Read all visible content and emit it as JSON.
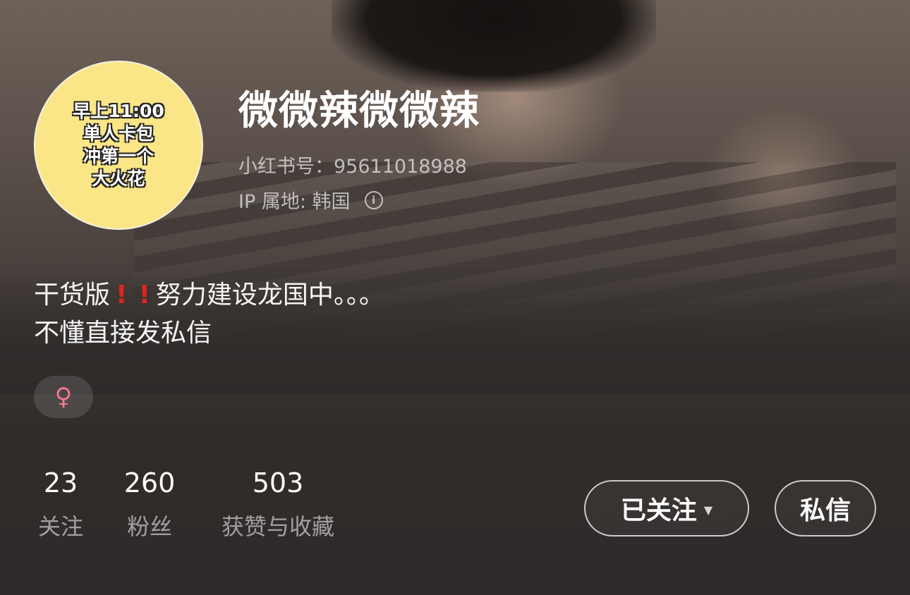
{
  "profile": {
    "avatar_lines": [
      "早上11:00",
      "单人卡包",
      "冲第一个",
      "大火花"
    ],
    "name": "微微辣微微辣",
    "red_id": "小红书号：95611018988",
    "ip": "IP 属地: 韩国",
    "bio": {
      "line1_start": "干货版",
      "bang": "!",
      "line1_end": "努力建设龙国中。。。",
      "line2": "不懂直接发私信"
    },
    "gender_symbol": "♀",
    "gender_icon": "female-icon"
  },
  "stats": [
    {
      "value": "23",
      "label": "关注"
    },
    {
      "value": "260",
      "label": "粉丝"
    },
    {
      "value": "503",
      "label": "获赞与收藏"
    }
  ],
  "actions": {
    "follow_label": "已关注",
    "follow_caret": "▼",
    "message_label": "私信"
  },
  "colors": {
    "avatar_bg": "#fbe687",
    "exclamation": "#e0261f",
    "female": "#f2788e"
  }
}
